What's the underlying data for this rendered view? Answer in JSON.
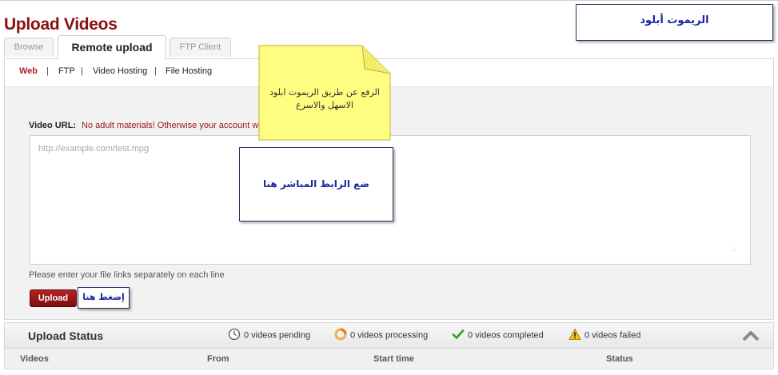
{
  "page": {
    "title": "Upload Videos"
  },
  "tabs": [
    {
      "label": "Browse"
    },
    {
      "label": "Remote upload"
    },
    {
      "label": "FTP Client"
    }
  ],
  "subnav": {
    "items": [
      {
        "label": "Web"
      },
      {
        "label": "FTP"
      },
      {
        "label": "Video Hosting"
      },
      {
        "label": "File Hosting"
      }
    ],
    "separator": "|"
  },
  "form": {
    "url_label": "Video URL:",
    "url_warning": "No adult materials! Otherwise your account w",
    "url_value": "",
    "url_placeholder": "http://example.com/test.mpg",
    "hint": "Please enter your file links separately on each line",
    "upload_label": "Upload",
    "resize_grip": "∴"
  },
  "status": {
    "title": "Upload Status",
    "pending": "0 videos pending",
    "processing": "0 videos processing",
    "completed": "0 videos completed",
    "failed": "0 videos failed"
  },
  "table": {
    "columns": [
      "Videos",
      "From",
      "Start time",
      "Status"
    ]
  },
  "annotations": {
    "title_note": "الريموت أبلود",
    "sticky_note": "الرفع عن طريق الريموت ابلود الاسهل والاسرع",
    "url_note": "ضع الرابط المباشر هنا",
    "click_note": "إضغط هنا"
  },
  "colors": {
    "brand": "#8b0f0f",
    "active_link": "#b02525",
    "warning": "#9a1717",
    "annotation_text": "#1a2aa0",
    "sticky_fill": "#fffd80"
  },
  "icons": {
    "pending": "clock-icon",
    "processing": "spinner-icon",
    "completed": "checkmark-icon",
    "failed": "warning-icon",
    "collapse": "chevron-up-icon"
  }
}
